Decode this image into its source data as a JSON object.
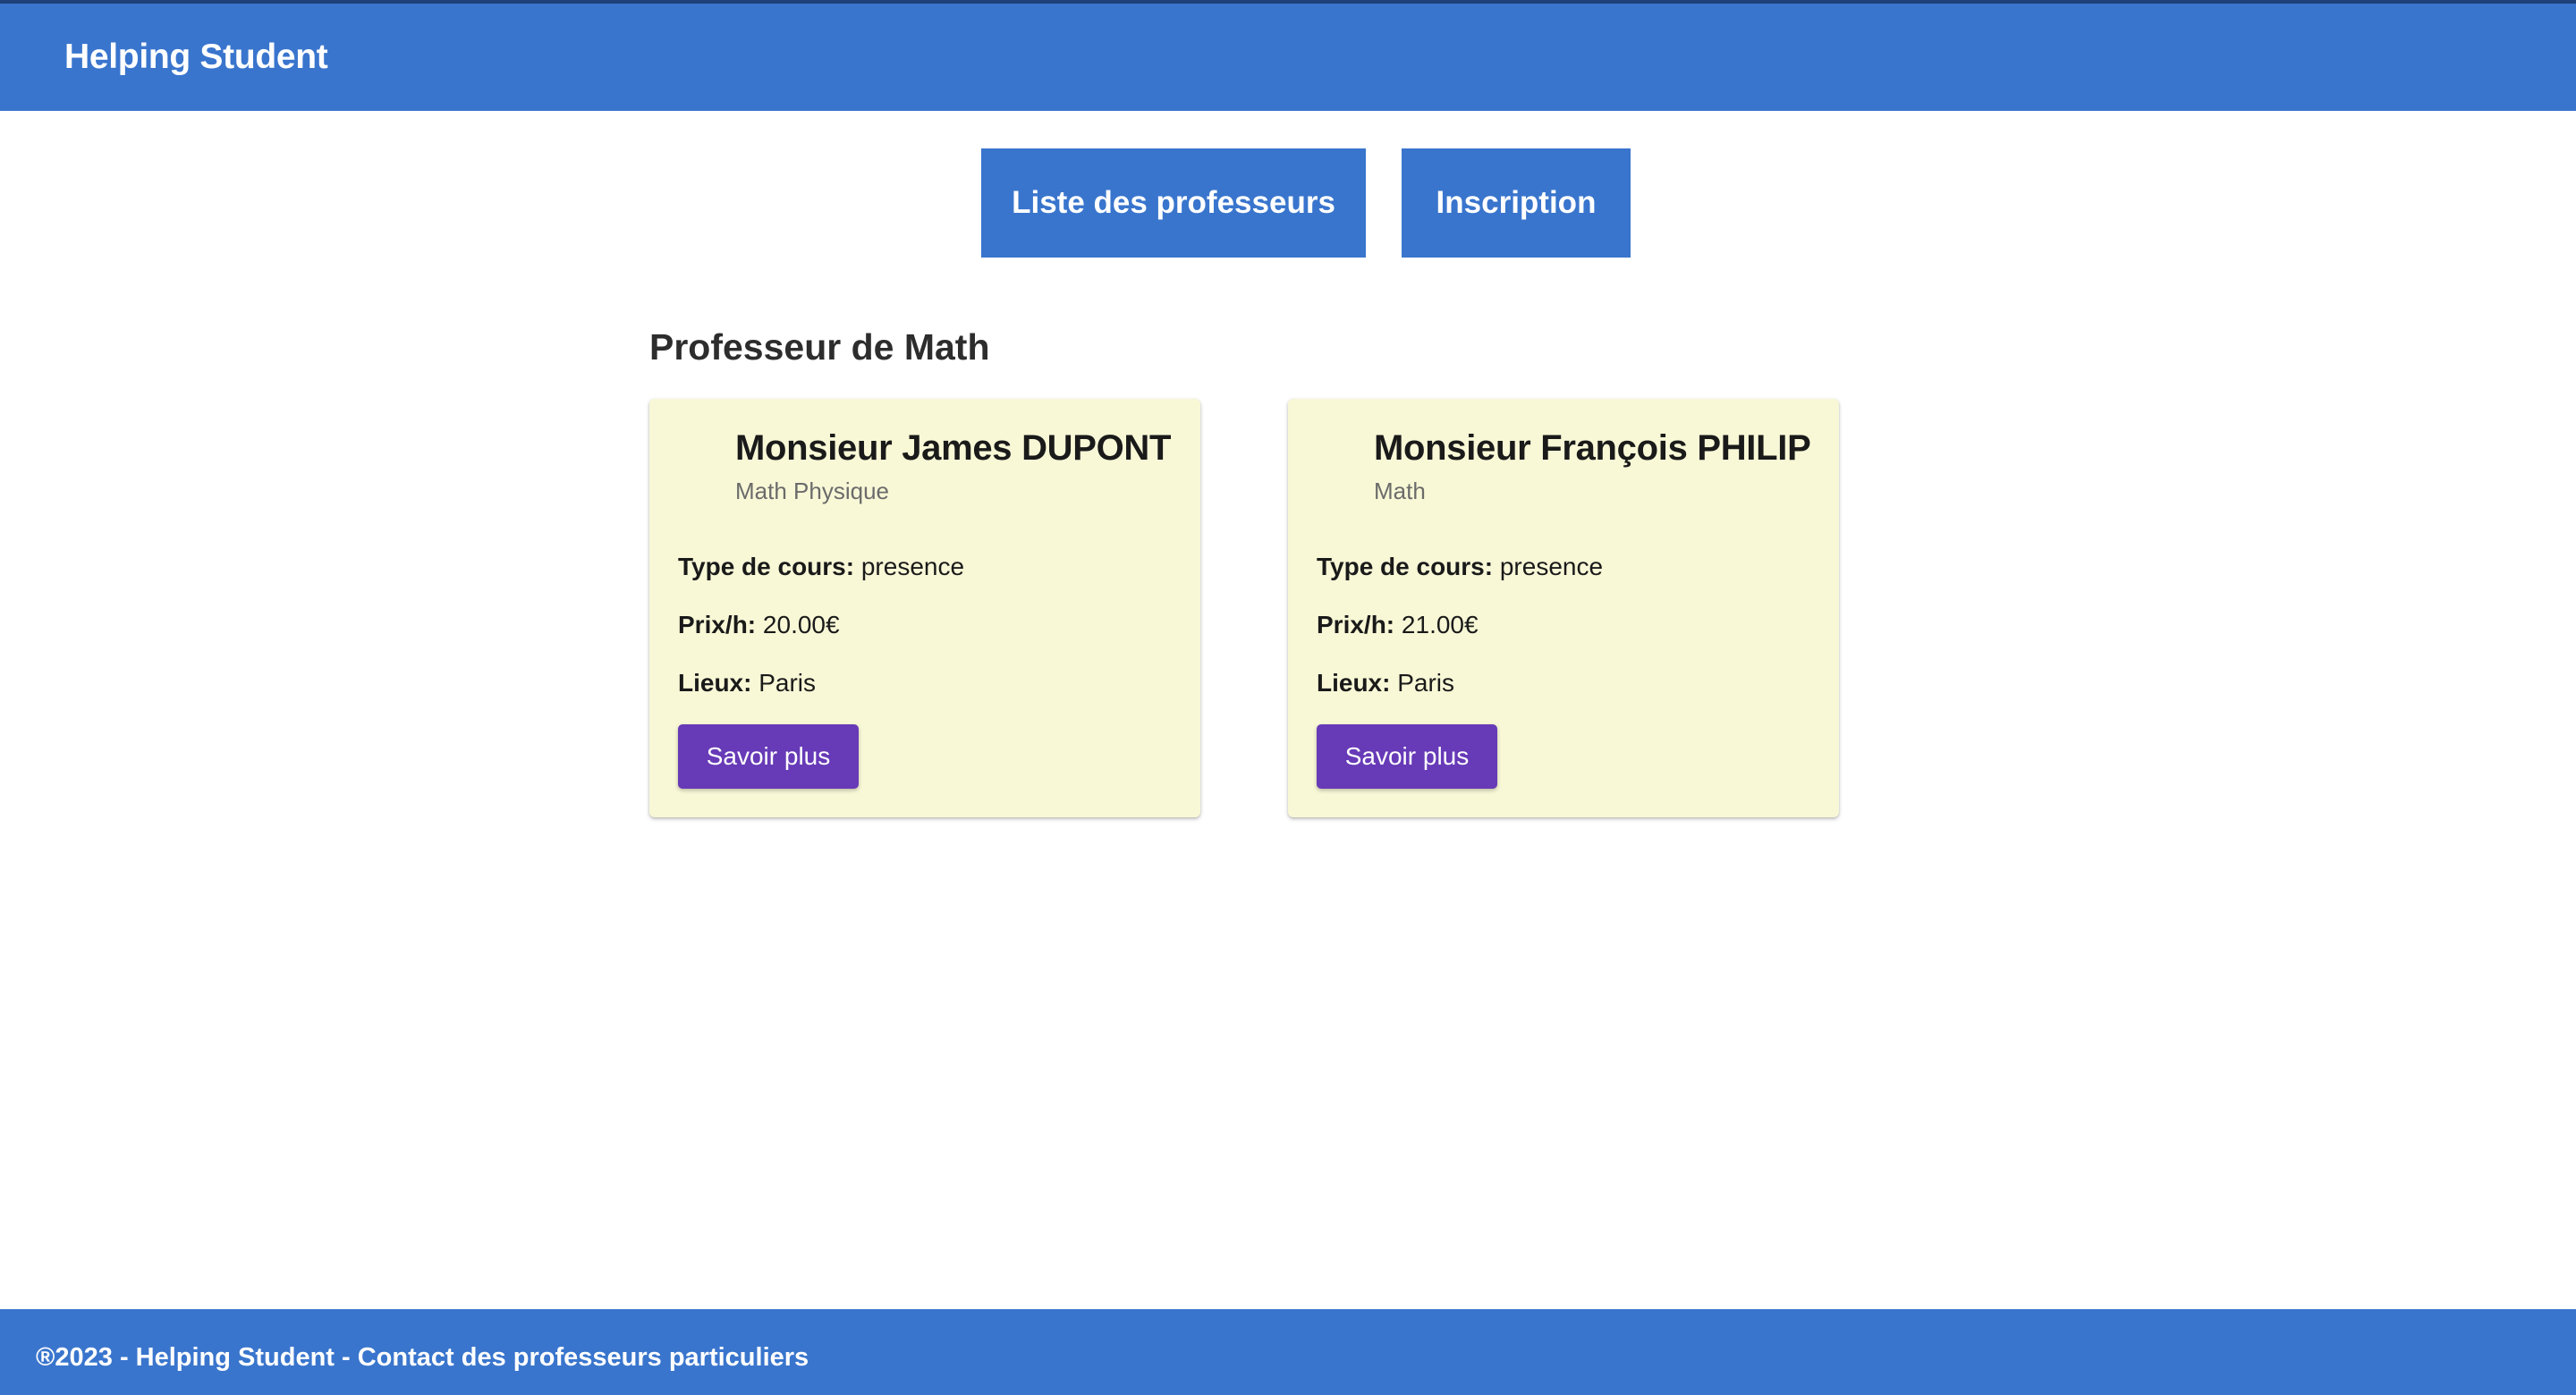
{
  "header": {
    "brand": "Helping Student"
  },
  "nav": {
    "list_label": "Liste des professeurs",
    "register_label": "Inscription"
  },
  "section": {
    "title": "Professeur de Math"
  },
  "teachers": [
    {
      "name": "Monsieur James DUPONT",
      "subject": "Math Physique",
      "type_label": "Type de cours:",
      "type_value": "presence",
      "price_label": "Prix/h:",
      "price_value": "20.00€",
      "place_label": "Lieux:",
      "place_value": "Paris",
      "button_label": "Savoir plus"
    },
    {
      "name": "Monsieur François PHILIP",
      "subject": "Math",
      "type_label": "Type de cours:",
      "type_value": "presence",
      "price_label": "Prix/h:",
      "price_value": "21.00€",
      "place_label": "Lieux:",
      "place_value": "Paris",
      "button_label": "Savoir plus"
    }
  ],
  "footer": {
    "text": "®2023 - Helping Student - Contact des professeurs particuliers"
  },
  "colors": {
    "primary": "#3975cd",
    "card_bg": "#f8f8d7",
    "action": "#673ab7"
  }
}
